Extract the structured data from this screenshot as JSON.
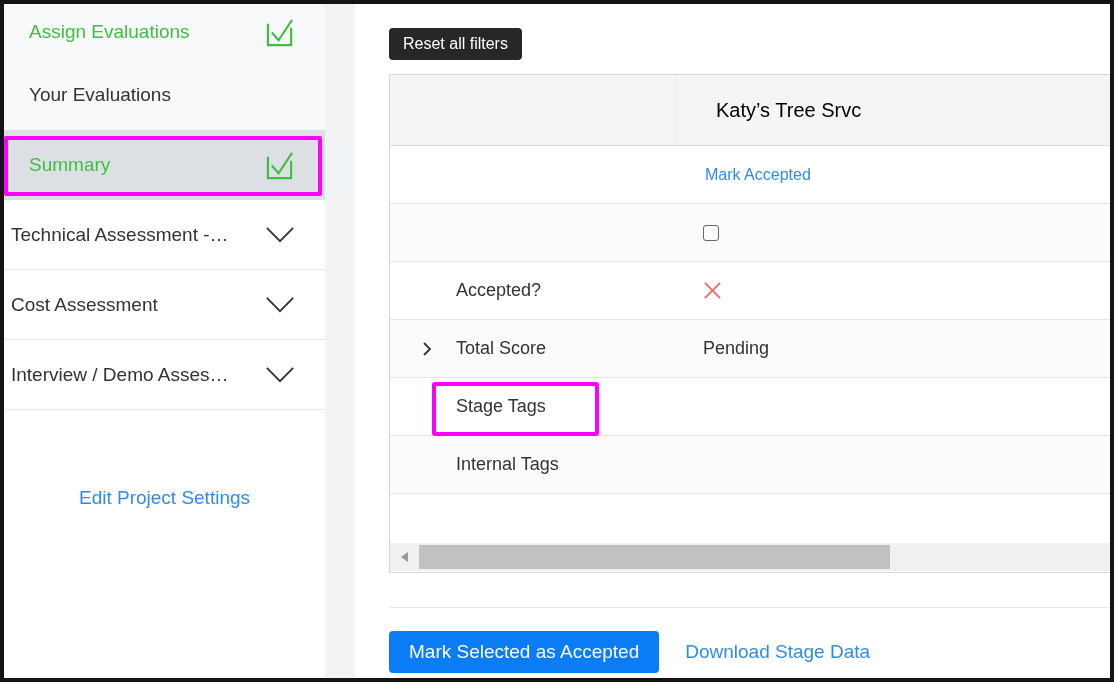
{
  "sidebar": {
    "items": [
      {
        "kind": "step",
        "label": "Assign Evaluations",
        "done": true,
        "selected": false,
        "highlighted": false
      },
      {
        "kind": "step",
        "label": "Your Evaluations",
        "done": false,
        "selected": false,
        "highlighted": false
      },
      {
        "kind": "step",
        "label": "Summary",
        "done": true,
        "selected": true,
        "highlighted": true
      },
      {
        "kind": "section",
        "label": "Technical Assessment -…",
        "expanded": false,
        "selected": false,
        "highlighted": false
      },
      {
        "kind": "section",
        "label": "Cost Assessment",
        "expanded": false,
        "selected": false,
        "highlighted": false
      },
      {
        "kind": "section",
        "label": "Interview / Demo Asses…",
        "expanded": false,
        "selected": false,
        "highlighted": false
      }
    ],
    "settings_link": "Edit Project Settings"
  },
  "reset_button": "Reset all filters",
  "table": {
    "column_header": "Katy’s Tree Srvc",
    "rows": [
      {
        "kind": "action",
        "value": "Mark Accepted",
        "highlighted": false
      },
      {
        "kind": "checkbox",
        "checked": false,
        "highlighted": false
      },
      {
        "kind": "status",
        "label": "Accepted?",
        "accepted": false,
        "highlighted": false
      },
      {
        "kind": "text",
        "label": "Total Score",
        "value": "Pending",
        "expanded": false,
        "highlighted": false
      },
      {
        "kind": "text",
        "label": "Stage Tags",
        "highlighted": true
      },
      {
        "kind": "text",
        "label": "Internal Tags",
        "highlighted": false
      }
    ]
  },
  "footer": {
    "primary_button": "Mark Selected as Accepted",
    "link": "Download Stage Data"
  }
}
